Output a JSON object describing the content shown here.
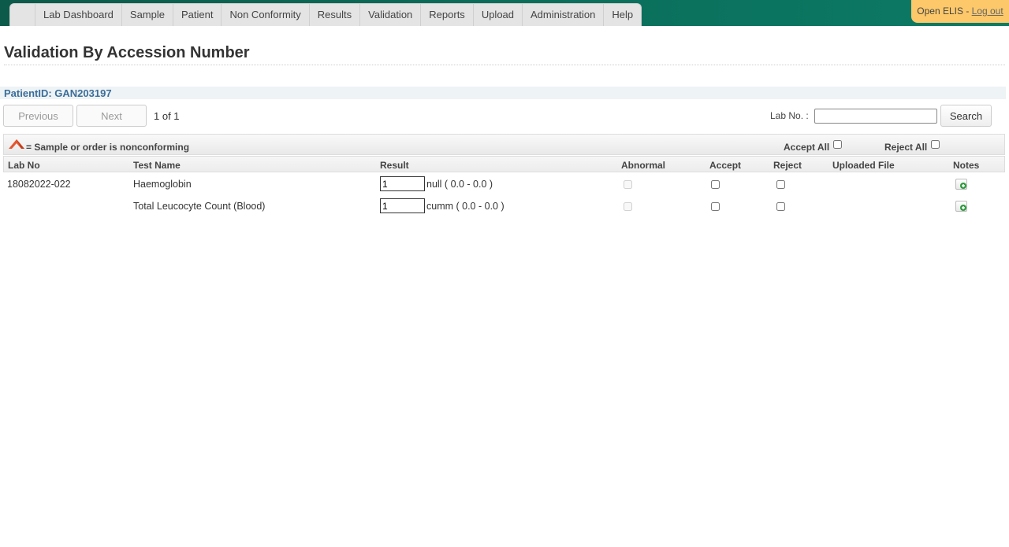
{
  "nav": {
    "items": [
      "Lab Dashboard",
      "Sample",
      "Patient",
      "Non Conformity",
      "Results",
      "Validation",
      "Reports",
      "Upload",
      "Administration",
      "Help"
    ]
  },
  "user": {
    "app_name": "Open ELIS - ",
    "logout_label": "Log out"
  },
  "page": {
    "title": "Validation By Accession Number"
  },
  "patient": {
    "label": "PatientID: GAN203197"
  },
  "pager": {
    "previous_label": "Previous",
    "next_label": "Next",
    "status": "1 of 1"
  },
  "search": {
    "label": "Lab No. :",
    "value": "",
    "button_label": "Search"
  },
  "legend": {
    "text": "= Sample or order is nonconforming",
    "accept_all_label": "Accept All",
    "reject_all_label": "Reject All"
  },
  "table": {
    "headers": [
      "Lab No",
      "Test Name",
      "Result",
      "Abnormal",
      "Accept",
      "Reject",
      "Uploaded File",
      "Notes"
    ],
    "rows": [
      {
        "lab_no": "18082022-022",
        "test_name": "Haemoglobin",
        "result": "1",
        "range": "null ( 0.0 - 0.0 )"
      },
      {
        "lab_no": "",
        "test_name": "Total Leucocyte Count (Blood)",
        "result": "1",
        "range": "cumm ( 0.0 - 0.0 )"
      }
    ]
  },
  "colors": {
    "topbar": "#0a6d5a",
    "user_box": "#fcc86a",
    "patient_id": "#3b6e9a",
    "nonconforming_flag": "#e4572e"
  }
}
